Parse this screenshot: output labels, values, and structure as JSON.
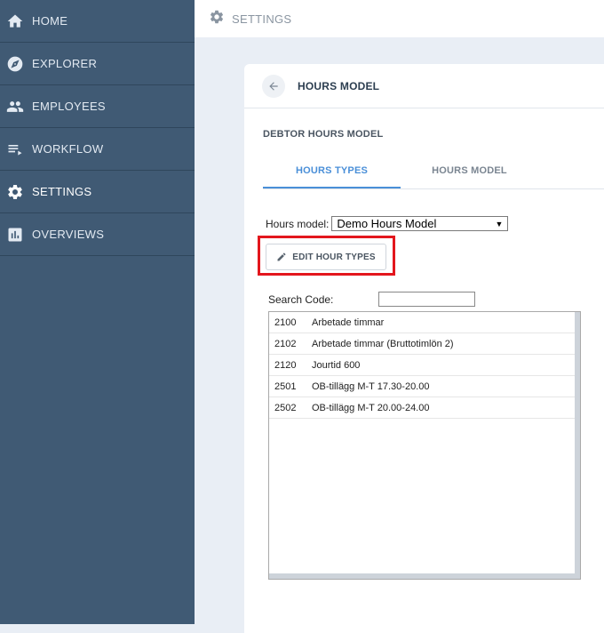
{
  "sidebar": {
    "items": [
      {
        "label": "HOME",
        "icon": "home-icon"
      },
      {
        "label": "EXPLORER",
        "icon": "compass-icon"
      },
      {
        "label": "EMPLOYEES",
        "icon": "people-icon"
      },
      {
        "label": "WORKFLOW",
        "icon": "playlist-icon"
      },
      {
        "label": "SETTINGS",
        "icon": "gear-icon",
        "active": true
      },
      {
        "label": "OVERVIEWS",
        "icon": "bar-chart-icon"
      }
    ]
  },
  "topbar": {
    "title": "SETTINGS",
    "icon": "gear-icon"
  },
  "card": {
    "title": "HOURS MODEL",
    "section_title": "DEBTOR HOURS MODEL",
    "tabs": [
      {
        "label": "HOURS TYPES",
        "active": true
      },
      {
        "label": "HOURS MODEL",
        "active": false
      }
    ],
    "hours_model_label": "Hours model:",
    "hours_model_value": "Demo Hours Model",
    "edit_button_label": "EDIT HOUR TYPES",
    "search_label": "Search Code:",
    "search_value": "",
    "rows": [
      {
        "code": "2100",
        "name": "Arbetade timmar"
      },
      {
        "code": "2102",
        "name": "Arbetade timmar (Bruttotimlön 2)"
      },
      {
        "code": "2120",
        "name": "Jourtid 600"
      },
      {
        "code": "2501",
        "name": "OB-tillägg M-T 17.30-20.00"
      },
      {
        "code": "2502",
        "name": "OB-tillägg M-T 20.00-24.00"
      }
    ]
  },
  "colors": {
    "sidebar_bg": "#405a74",
    "accent": "#4a8fd8",
    "highlight": "#e3161d"
  }
}
